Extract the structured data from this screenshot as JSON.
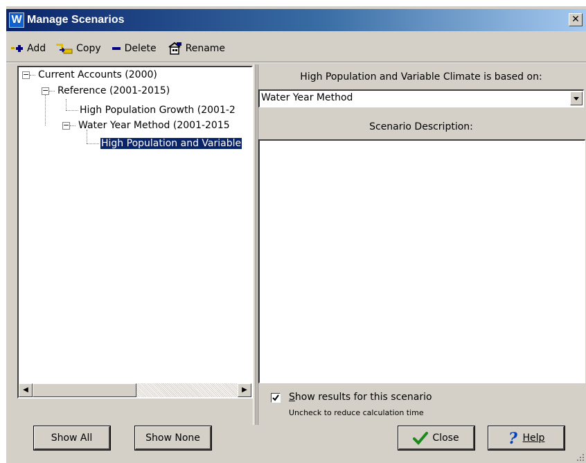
{
  "window": {
    "title": "Manage Scenarios",
    "app_icon_letter": "W",
    "close_glyph": "✕"
  },
  "toolbar": {
    "add_label": "Add",
    "copy_label": "Copy",
    "delete_label": "Delete",
    "rename_label": "Rename"
  },
  "tree": {
    "items": [
      {
        "label": "Current Accounts (2000)",
        "expanded": true
      },
      {
        "label": "Reference (2001-2015)",
        "expanded": true
      },
      {
        "label": "High Population Growth (2001-2"
      },
      {
        "label": "Water Year Method (2001-2015",
        "expanded": true
      },
      {
        "label": "High Population and Variable",
        "selected": true
      }
    ]
  },
  "right": {
    "based_on_label": "High Population and Variable Climate is based on:",
    "based_on_value": "Water Year Method",
    "description_label": "Scenario Description:",
    "description_text": "",
    "show_results_label": "Show results for this scenario",
    "show_results_checked": true,
    "show_results_hint": "Uncheck to reduce calculation time"
  },
  "buttons": {
    "show_all": "Show All",
    "show_none": "Show None",
    "close": "Close",
    "help": "Help"
  },
  "colors": {
    "selection": "#0a246a",
    "face": "#d4d0c8",
    "titlebar_start": "#0a246a",
    "titlebar_end": "#a6caf0"
  }
}
